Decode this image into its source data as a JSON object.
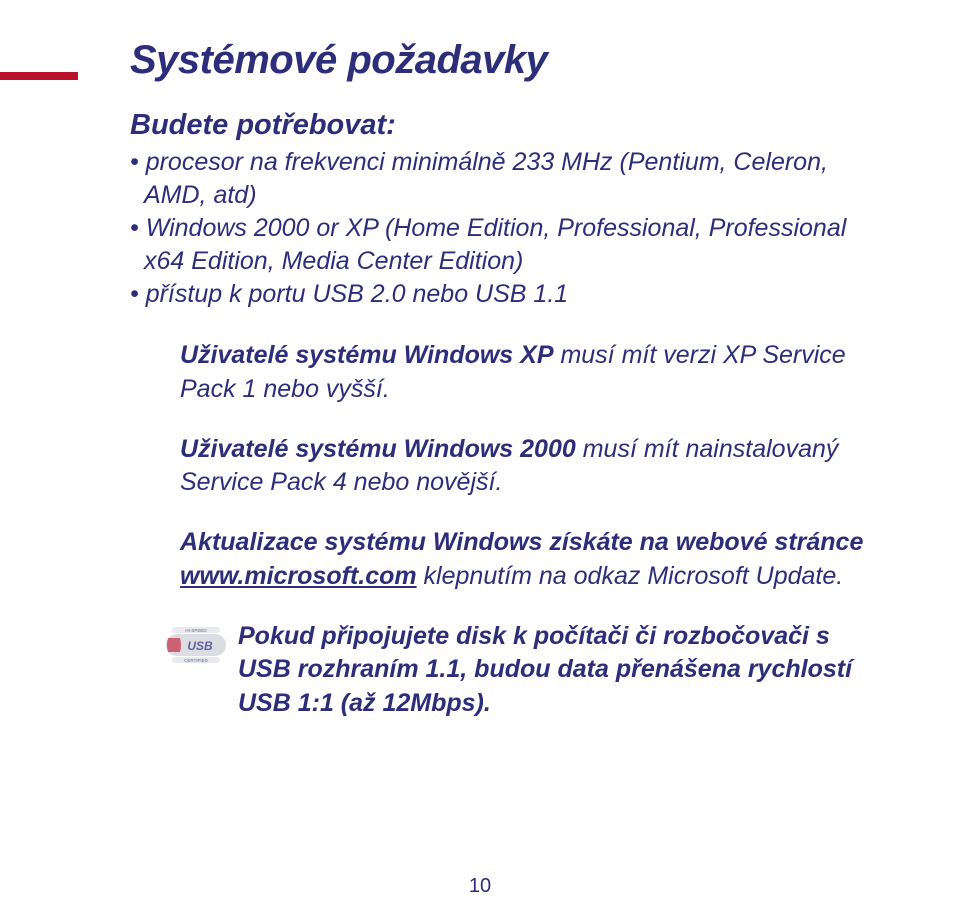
{
  "heading": "Systémové požadavky",
  "subhead": "Budete potřebovat:",
  "bullets": [
    "procesor na frekvenci minimálně 233 MHz (Pentium, Celeron, AMD, atd)",
    "Windows 2000 or XP (Home Edition, Professional, Professional x64 Edition, Media Center Edition)",
    "přístup k portu USB 2.0 nebo USB 1.1"
  ],
  "p1": {
    "lead": "Uživatelé systému Windows XP",
    "rest": " musí mít verzi XP Service Pack 1 nebo vyšší."
  },
  "p2": {
    "lead": "Uživatelé systému Windows 2000",
    "rest": " musí mít nainstalovaný Service Pack 4 nebo novější."
  },
  "p3": {
    "lead": "Aktualizace systému Windows získáte na webové stránce ",
    "link": "www.microsoft.com",
    "mid": " klepnutím na odkaz ",
    "tail_bold": "Microsoft Update",
    "tail": "."
  },
  "p4": "Pokud připojujete disk k počítači či rozbočovači s USB rozhraním 1.1, budou data přenášena rychlostí USB 1:1 (až 12Mbps).",
  "usb_badge": {
    "top_text": "HI-SPEED",
    "main_text": "USB",
    "sub_text": "CERTIFIED"
  },
  "page_number": "10"
}
